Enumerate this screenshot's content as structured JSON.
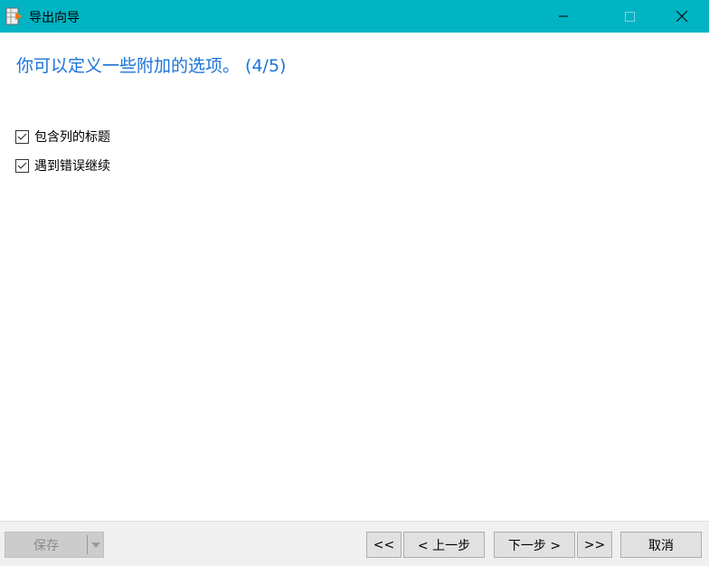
{
  "window": {
    "title": "导出向导",
    "colors": {
      "titlebar": "#00b4c3",
      "accent": "#1a73d9"
    }
  },
  "heading": "你可以定义一些附加的选项。 (4/5)",
  "options": [
    {
      "label": "包含列的标题",
      "checked": true
    },
    {
      "label": "遇到错误继续",
      "checked": true
    }
  ],
  "footer": {
    "save": "保存",
    "first": "<<",
    "prev": "< 上一步",
    "next": "下一步 >",
    "last": ">>",
    "cancel": "取消"
  }
}
